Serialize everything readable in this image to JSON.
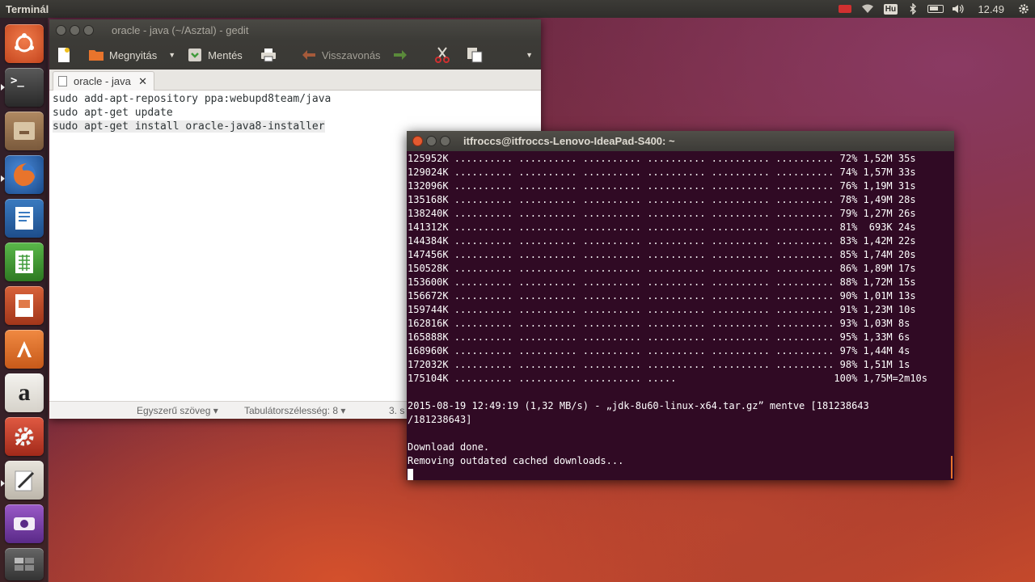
{
  "top_panel": {
    "app_title": "Terminál",
    "keyboard_layout": "Hu",
    "clock": "12.49"
  },
  "launcher": {
    "items": [
      {
        "name": "ubuntu-dash",
        "color": "#d4562b"
      },
      {
        "name": "terminal",
        "color": "#3a3a3a"
      },
      {
        "name": "files",
        "color": "#8a6a48"
      },
      {
        "name": "firefox",
        "color": "#e0722a"
      },
      {
        "name": "libreoffice-writer",
        "color": "#2f6aa8"
      },
      {
        "name": "libreoffice-calc",
        "color": "#3f9a3a"
      },
      {
        "name": "libreoffice-impress",
        "color": "#c0462a"
      },
      {
        "name": "software-center",
        "color": "#e8742c"
      },
      {
        "name": "amazon",
        "color": "#e9e6df"
      },
      {
        "name": "system-settings",
        "color": "#c8412f"
      },
      {
        "name": "text-editor",
        "color": "#d8d4cc"
      },
      {
        "name": "webcam-app",
        "color": "#7a3fa0"
      },
      {
        "name": "workspaces",
        "color": "#555"
      }
    ]
  },
  "gedit": {
    "title": "oracle - java (~/Asztal) - gedit",
    "toolbar": {
      "open_label": "Megnyitás",
      "save_label": "Mentés",
      "undo_label": "Visszavonás"
    },
    "tab_label": "oracle - java",
    "lines": [
      "sudo add-apt-repository ppa:webupd8team/java",
      "sudo apt-get update",
      "sudo apt-get install oracle-java8-installer"
    ],
    "status": {
      "mode": "Egyszerű szöveg",
      "tab_width": "Tabulátorszélesség: 8",
      "position": "3. s"
    }
  },
  "terminal": {
    "title": "itfroccs@itfroccs-Lenovo-IdeaPad-S400: ~",
    "progress_lines": [
      "125952K .......... .......... .......... .......... .......... .......... 72% 1,52M 35s",
      "129024K .......... .......... .......... .......... .......... .......... 74% 1,57M 33s",
      "132096K .......... .......... .......... .......... .......... .......... 76% 1,19M 31s",
      "135168K .......... .......... .......... .......... .......... .......... 78% 1,49M 28s",
      "138240K .......... .......... .......... .......... .......... .......... 79% 1,27M 26s",
      "141312K .......... .......... .......... .......... .......... .......... 81%  693K 24s",
      "144384K .......... .......... .......... .......... .......... .......... 83% 1,42M 22s",
      "147456K .......... .......... .......... .......... .......... .......... 85% 1,74M 20s",
      "150528K .......... .......... .......... .......... .......... .......... 86% 1,89M 17s",
      "153600K .......... .......... .......... .......... .......... .......... 88% 1,72M 15s",
      "156672K .......... .......... .......... .......... .......... .......... 90% 1,01M 13s",
      "159744K .......... .......... .......... .......... .......... .......... 91% 1,23M 10s",
      "162816K .......... .......... .......... .......... .......... .......... 93% 1,03M 8s",
      "165888K .......... .......... .......... .......... .......... .......... 95% 1,33M 6s",
      "168960K .......... .......... .......... .......... .......... .......... 97% 1,44M 4s",
      "172032K .......... .......... .......... .......... .......... .......... 98% 1,51M 1s",
      "175104K .......... .......... .......... .....                           100% 1,75M=2m10s"
    ],
    "blank1": "",
    "saved_line_1": "2015-08-19 12:49:19 (1,32 MB/s) - „jdk-8u60-linux-x64.tar.gz” mentve [181238643",
    "saved_line_2": "/181238643]",
    "blank2": "",
    "done_line": "Download done.",
    "removing_line": "Removing outdated cached downloads..."
  }
}
